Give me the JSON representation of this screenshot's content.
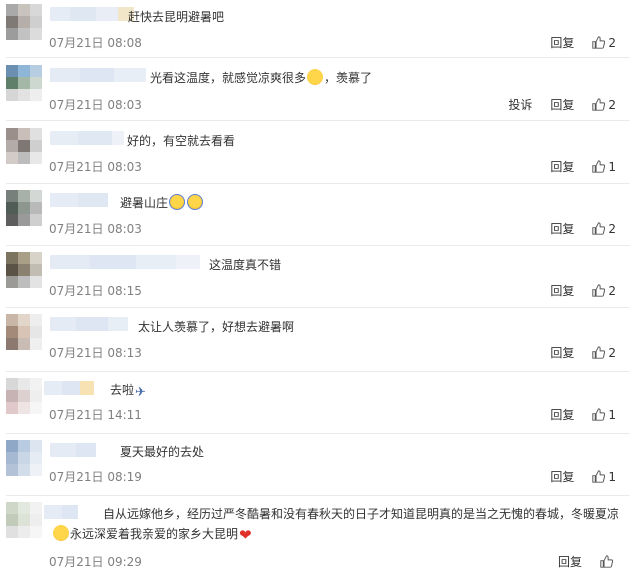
{
  "ui": {
    "reply_label": "回复",
    "report_label": "投诉"
  },
  "comments": [
    {
      "text": "赶快去昆明避暑吧",
      "time": "07月21日 08:08",
      "likes": "2"
    },
    {
      "text": "光看这温度，就感觉凉爽很多",
      "text_after": "，羡慕了",
      "time": "07月21日 08:03",
      "likes": "2",
      "report": true
    },
    {
      "text": "好的，有空就去看看",
      "time": "07月21日 08:03",
      "likes": "1"
    },
    {
      "text": "避暑山庄",
      "time": "07月21日 08:03",
      "likes": "2"
    },
    {
      "text": "这温度真不错",
      "time": "07月21日 08:15",
      "likes": "2"
    },
    {
      "text": "太让人羡慕了，好想去避暑啊",
      "time": "07月21日 08:13",
      "likes": "2"
    },
    {
      "text": "去啦",
      "time": "07月21日 14:11",
      "likes": "1"
    },
    {
      "text": "夏天最好的去处",
      "time": "07月21日 08:19",
      "likes": "1"
    },
    {
      "text": "自从远嫁他乡，经历过严冬酷暑和没有春秋天的日子才知道昆明真的是当之无愧的春城，冬暖夏凉",
      "text2": "永远深爱着我亲爱的家乡大昆明",
      "time": "07月21日 09:29",
      "likes": ""
    }
  ],
  "icons": [
    "thumbs-up-icon",
    "smile-emoji-icon",
    "scream-emoji-icon",
    "airplane-emoji-icon",
    "red-heart-emoji-icon",
    "blurred-avatar"
  ]
}
